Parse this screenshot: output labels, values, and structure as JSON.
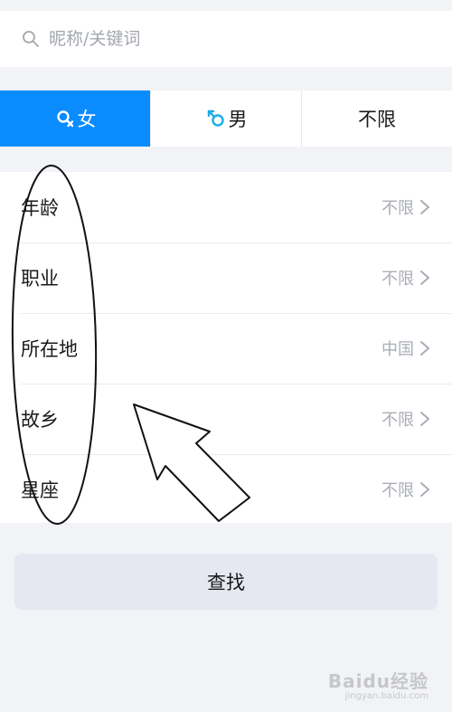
{
  "search": {
    "placeholder": "昵称/关键词"
  },
  "gender_tabs": [
    {
      "label": "女",
      "icon": "female-icon",
      "active": true
    },
    {
      "label": "男",
      "icon": "male-icon",
      "active": false
    },
    {
      "label": "不限",
      "active": false
    }
  ],
  "filters": [
    {
      "label": "年龄",
      "value": "不限"
    },
    {
      "label": "职业",
      "value": "不限"
    },
    {
      "label": "所在地",
      "value": "中国"
    },
    {
      "label": "故乡",
      "value": "不限"
    },
    {
      "label": "星座",
      "value": "不限"
    }
  ],
  "find_button": {
    "label": "查找"
  },
  "colors": {
    "accent": "#0a8cff",
    "male_icon": "#1aaee8",
    "background": "#f2f3f7"
  },
  "watermark": {
    "brand": "Baidu经验",
    "sub": "jingyan.baidu.com"
  }
}
